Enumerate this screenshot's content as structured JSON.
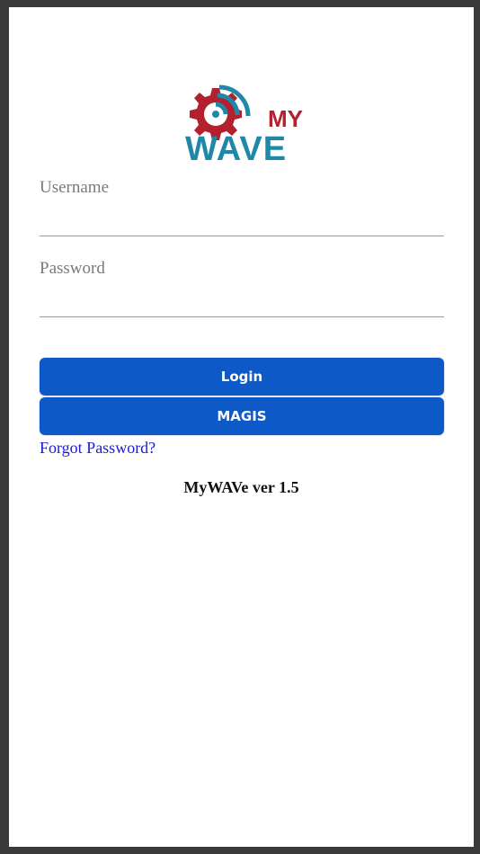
{
  "logo": {
    "text_top": "MY",
    "text_bottom": "WAVE",
    "colors": {
      "red": "#b3202e",
      "teal": "#1f87a8"
    }
  },
  "form": {
    "username_label": "Username",
    "username_value": "",
    "password_label": "Password",
    "password_value": ""
  },
  "buttons": {
    "login_label": "Login",
    "magis_label": "MAGIS"
  },
  "links": {
    "forgot_password": "Forgot Password?"
  },
  "footer": {
    "version": "MyWAVe ver 1.5"
  },
  "colors": {
    "primary_button": "#0d59c8",
    "link": "#1a1ad6"
  }
}
